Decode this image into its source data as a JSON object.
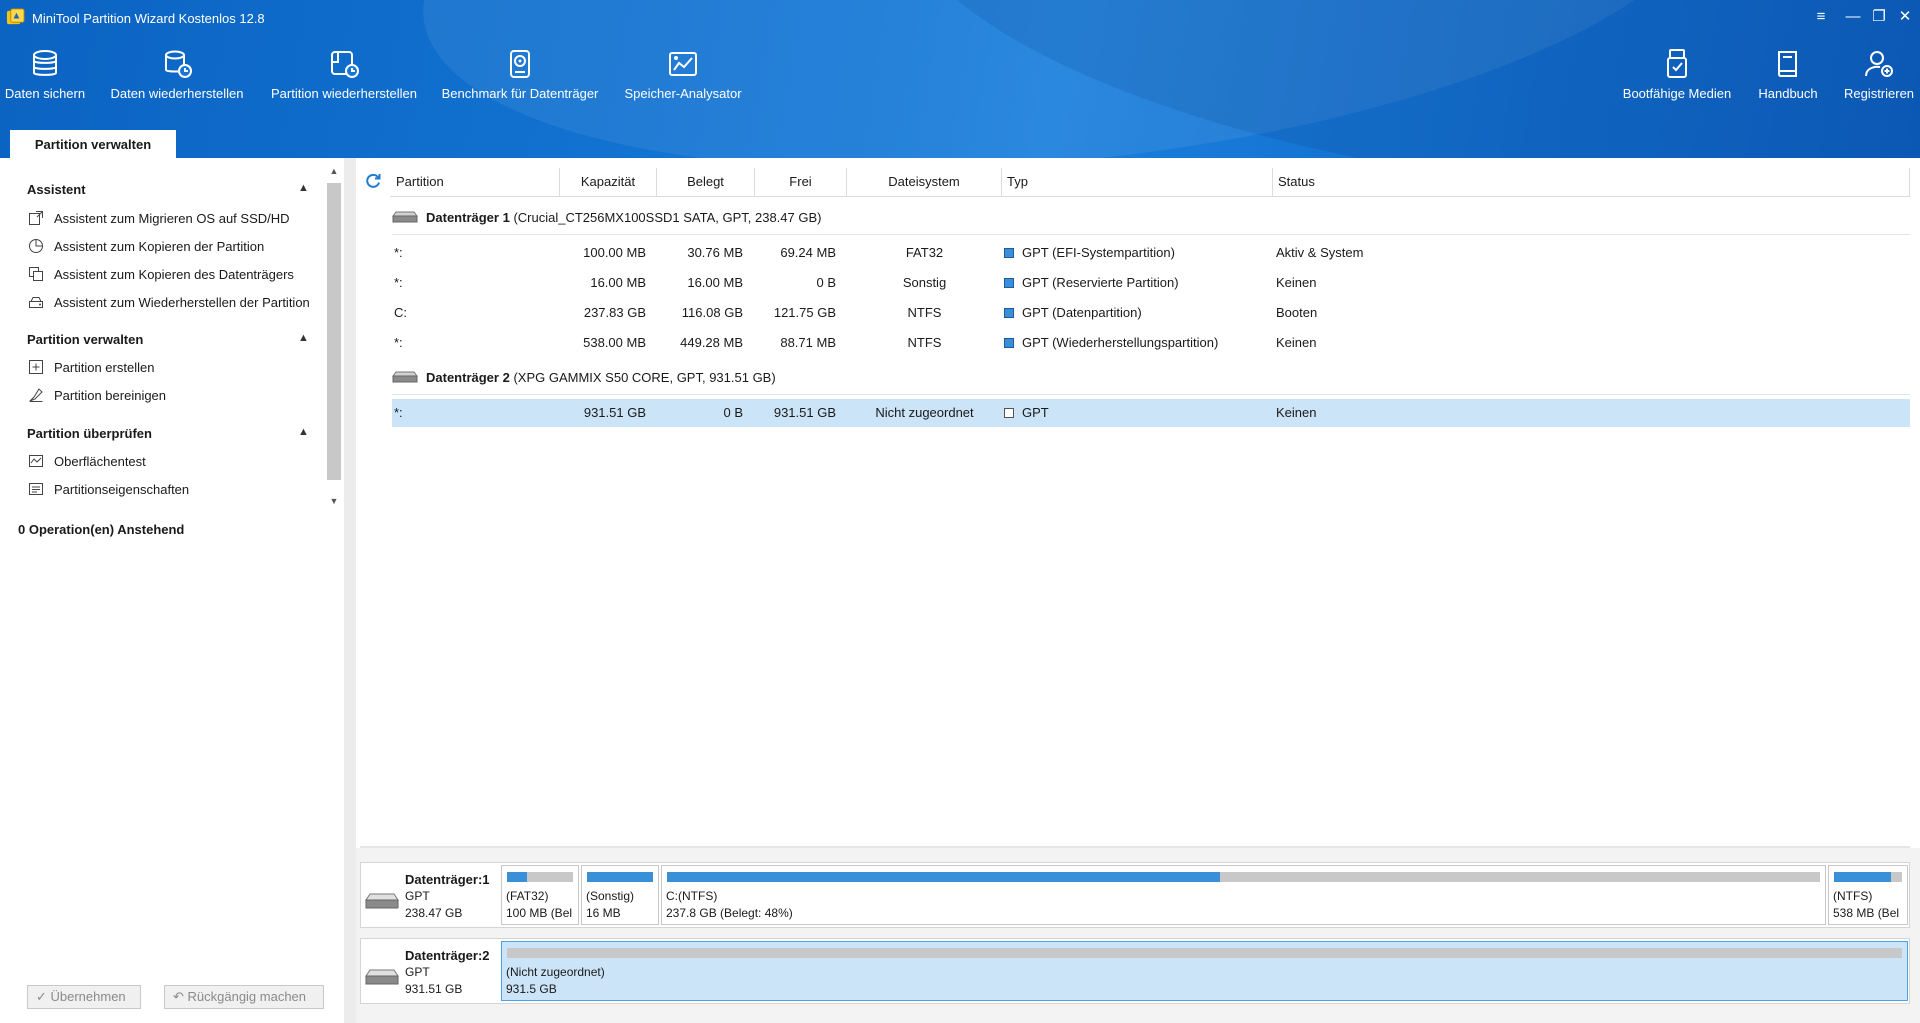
{
  "window": {
    "title": "MiniTool Partition Wizard Kostenlos 12.8",
    "controls": [
      "≡",
      "—",
      "❐",
      "✕"
    ]
  },
  "toolbar": {
    "left": [
      {
        "label": "Daten sichern",
        "icon": "database-backup-icon"
      },
      {
        "label": "Daten wiederherstellen",
        "icon": "data-recovery-icon"
      },
      {
        "label": "Partition wiederherstellen",
        "icon": "partition-recovery-icon"
      },
      {
        "label": "Benchmark für Datenträger",
        "icon": "disk-benchmark-icon"
      },
      {
        "label": "Speicher-Analysator",
        "icon": "space-analyzer-icon"
      }
    ],
    "right": [
      {
        "label": "Bootfähige Medien",
        "icon": "bootable-media-icon"
      },
      {
        "label": "Handbuch",
        "icon": "manual-book-icon"
      },
      {
        "label": "Registrieren",
        "icon": "register-user-icon"
      }
    ]
  },
  "tab": {
    "label": "Partition verwalten"
  },
  "sidebar": {
    "sections": [
      {
        "title": "Assistent",
        "items": [
          {
            "label": "Assistent zum Migrieren OS auf SSD/HD",
            "icon": "migrate-os-icon"
          },
          {
            "label": "Assistent zum Kopieren der Partition",
            "icon": "copy-partition-icon"
          },
          {
            "label": "Assistent zum Kopieren des Datenträgers",
            "icon": "copy-disk-icon"
          },
          {
            "label": "Assistent zum Wiederherstellen der Partition",
            "icon": "restore-partition-icon"
          }
        ]
      },
      {
        "title": "Partition verwalten",
        "items": [
          {
            "label": "Partition erstellen",
            "icon": "create-partition-icon"
          },
          {
            "label": "Partition bereinigen",
            "icon": "wipe-partition-icon"
          }
        ]
      },
      {
        "title": "Partition überprüfen",
        "items": [
          {
            "label": "Oberflächentest",
            "icon": "surface-test-icon"
          },
          {
            "label": "Partitionseigenschaften",
            "icon": "properties-icon"
          }
        ]
      }
    ],
    "pending": "0 Operation(en) Anstehend",
    "apply_label": "✓ Übernehmen",
    "undo_label": "↶ Rückgängig machen"
  },
  "table": {
    "columns": [
      "Partition",
      "Kapazität",
      "Belegt",
      "Frei",
      "Dateisystem",
      "Typ",
      "Status"
    ],
    "disks": [
      {
        "name": "Datenträger 1",
        "detail": "(Crucial_CT256MX100SSD1 SATA, GPT, 238.47 GB)",
        "partitions": [
          {
            "partition": "*:",
            "capacity": "100.00 MB",
            "used": "30.76 MB",
            "free": "69.24 MB",
            "fs": "FAT32",
            "type": "GPT (EFI-Systempartition)",
            "status": "Aktiv & System"
          },
          {
            "partition": "*:",
            "capacity": "16.00 MB",
            "used": "16.00 MB",
            "free": "0 B",
            "fs": "Sonstig",
            "type": "GPT (Reservierte Partition)",
            "status": "Keinen"
          },
          {
            "partition": "C:",
            "capacity": "237.83 GB",
            "used": "116.08 GB",
            "free": "121.75 GB",
            "fs": "NTFS",
            "type": "GPT (Datenpartition)",
            "status": "Booten"
          },
          {
            "partition": "*:",
            "capacity": "538.00 MB",
            "used": "449.28 MB",
            "free": "88.71 MB",
            "fs": "NTFS",
            "type": "GPT (Wiederherstellungspartition)",
            "status": "Keinen"
          }
        ]
      },
      {
        "name": "Datenträger 2",
        "detail": "(XPG GAMMIX S50 CORE, GPT, 931.51 GB)",
        "partitions": [
          {
            "partition": "*:",
            "capacity": "931.51 GB",
            "used": "0 B",
            "free": "931.51 GB",
            "fs": "Nicht zugeordnet",
            "type": "GPT",
            "status": "Keinen",
            "selected": true
          }
        ]
      }
    ]
  },
  "diskmap": [
    {
      "name": "Datenträger:1",
      "style": "GPT",
      "size": "238.47 GB",
      "parts": [
        {
          "line1": "(FAT32)",
          "line2": "100 MB (Bel",
          "used_fraction": 0.31
        },
        {
          "line1": "(Sonstig)",
          "line2": "16 MB",
          "used_fraction": 1.0
        },
        {
          "line1": "C:(NTFS)",
          "line2": "237.8 GB (Belegt: 48%)",
          "used_fraction": 0.48
        },
        {
          "line1": "(NTFS)",
          "line2": "538 MB (Bel",
          "used_fraction": 0.84
        }
      ]
    },
    {
      "name": "Datenträger:2",
      "style": "GPT",
      "size": "931.51 GB",
      "parts": [
        {
          "line1": "(Nicht zugeordnet)",
          "line2": "931.5 GB",
          "used_fraction": 0.0,
          "selected": true
        }
      ]
    }
  ],
  "colors": {
    "header": "#1578d6",
    "selection": "#cce4f7",
    "used_bar": "#3a8fd9"
  }
}
